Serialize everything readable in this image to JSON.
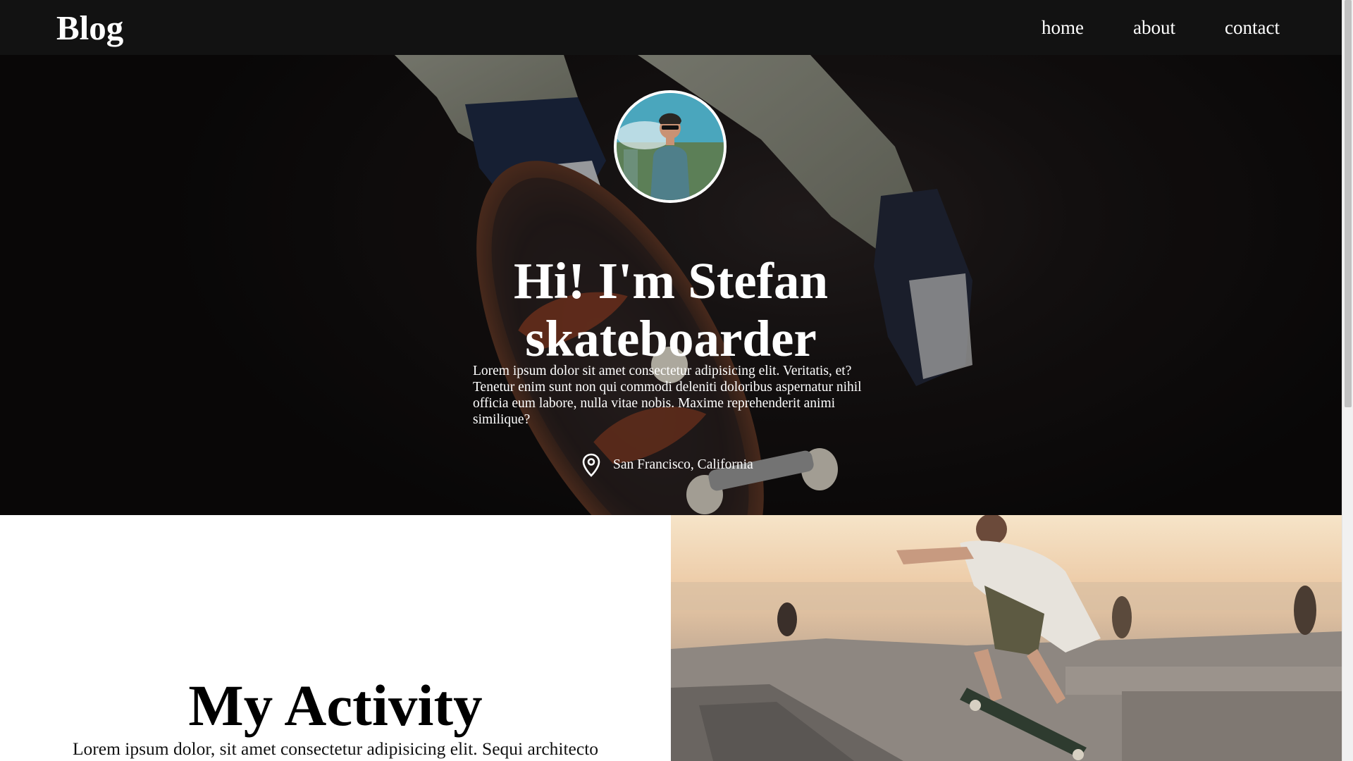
{
  "navbar": {
    "brand": "Blog",
    "links": [
      {
        "label": "home"
      },
      {
        "label": "about"
      },
      {
        "label": "contact"
      }
    ]
  },
  "hero": {
    "title_line1": "Hi! I'm Stefan",
    "title_line2": "skateboarder",
    "description": "Lorem ipsum dolor sit amet consectetur adipisicing elit. Veritatis, et? Tenetur enim sunt non qui commodi deleniti doloribus aspernatur nihil officia eum labore, nulla vitae nobis. Maxime reprehenderit animi similique?",
    "location": "San Francisco, California",
    "location_icon": "map-pin-icon"
  },
  "activity": {
    "title": "My Activity",
    "text": "Lorem ipsum dolor, sit amet consectetur adipisicing elit. Sequi architecto"
  },
  "colors": {
    "navbar_bg": "#121212",
    "text_light": "#ffffff",
    "text_dark": "#000000"
  }
}
